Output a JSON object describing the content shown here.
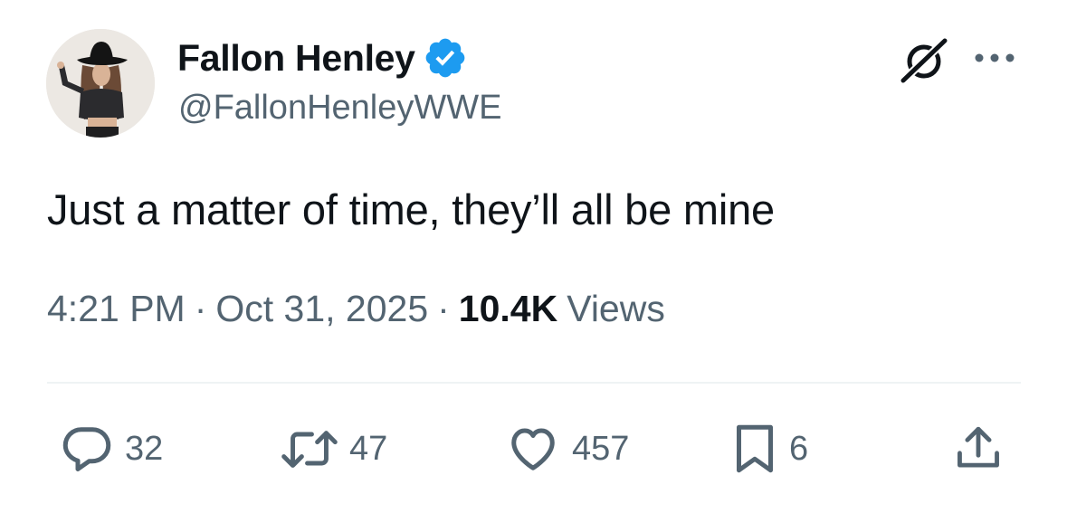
{
  "author": {
    "display_name": "Fallon Henley",
    "handle": "@FallonHenleyWWE",
    "verified": true,
    "avatar_icon": "profile-photo"
  },
  "tweet": {
    "text": "Just a matter of time, they’ll all be mine",
    "time": "4:21 PM",
    "separator": "·",
    "date": "Oct 31, 2025",
    "views_count": "10.4K",
    "views_label": "Views"
  },
  "header_icons": [
    "grok-icon",
    "more-icon"
  ],
  "actions": {
    "replies": "32",
    "reposts": "47",
    "likes": "457",
    "bookmarks": "6"
  },
  "colors": {
    "text_primary": "#0f1419",
    "text_secondary": "#536471",
    "verified_blue": "#1d9bf0",
    "divider": "#eff3f4"
  }
}
